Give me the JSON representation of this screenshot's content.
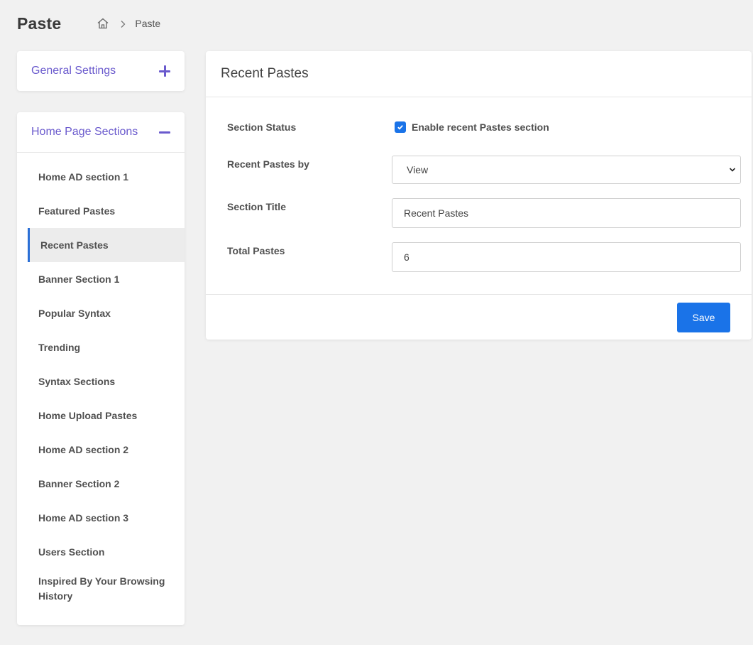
{
  "header": {
    "title": "Paste",
    "breadcrumb": {
      "home_icon": "home-icon",
      "current": "Paste"
    }
  },
  "general_settings": {
    "title": "General Settings",
    "icon": "plus-icon"
  },
  "home_page_sections": {
    "title": "Home Page Sections",
    "icon": "minus-icon",
    "items": [
      {
        "label": "Home AD section 1"
      },
      {
        "label": "Featured Pastes"
      },
      {
        "label": "Recent Pastes",
        "active": true
      },
      {
        "label": "Banner Section 1"
      },
      {
        "label": "Popular Syntax"
      },
      {
        "label": "Trending"
      },
      {
        "label": "Syntax Sections"
      },
      {
        "label": "Home Upload Pastes"
      },
      {
        "label": "Home AD section 2"
      },
      {
        "label": "Banner Section 2"
      },
      {
        "label": "Home AD section 3"
      },
      {
        "label": "Users Section"
      },
      {
        "label": "Inspired By Your Browsing History"
      }
    ]
  },
  "panel": {
    "title": "Recent Pastes",
    "section_status": {
      "label": "Section Status",
      "checkbox_label": "Enable recent Pastes section",
      "checked": true
    },
    "recent_pastes_by": {
      "label": "Recent Pastes by",
      "value": "View"
    },
    "section_title": {
      "label": "Section Title",
      "value": "Recent Pastes"
    },
    "total_pastes": {
      "label": "Total Pastes",
      "value": "6"
    },
    "save_label": "Save"
  },
  "colors": {
    "accent": "#6a5acd",
    "primary": "#1a73e8",
    "active_border": "#2a6fd6"
  }
}
